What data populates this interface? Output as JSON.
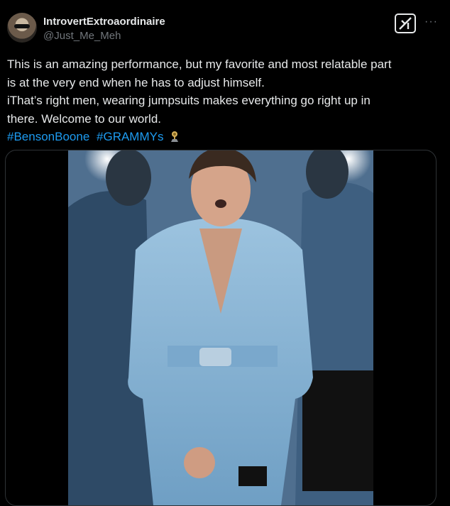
{
  "tweet": {
    "author_name": "IntrovertExtroaordinaire",
    "author_handle": "@Just_Me_Meh",
    "more_label": "···",
    "lines": [
      "This is an amazing performance, but my favorite and  most relatable part",
      "is at the very end when he has to adjust himself.",
      "iThat’s right men,  wearing jumpsuits makes everything go right up in",
      "there. Welcome to our world."
    ],
    "hashtags": [
      "#BensonBoone",
      "#GRAMMYs"
    ]
  },
  "icons": {
    "x_logo": "grok-logo-icon",
    "more": "more-options-icon",
    "grammy": "grammy-award-icon"
  },
  "colors": {
    "background": "#000000",
    "text": "#e7e9ea",
    "secondary": "#71767b",
    "link": "#1d9bf0"
  }
}
